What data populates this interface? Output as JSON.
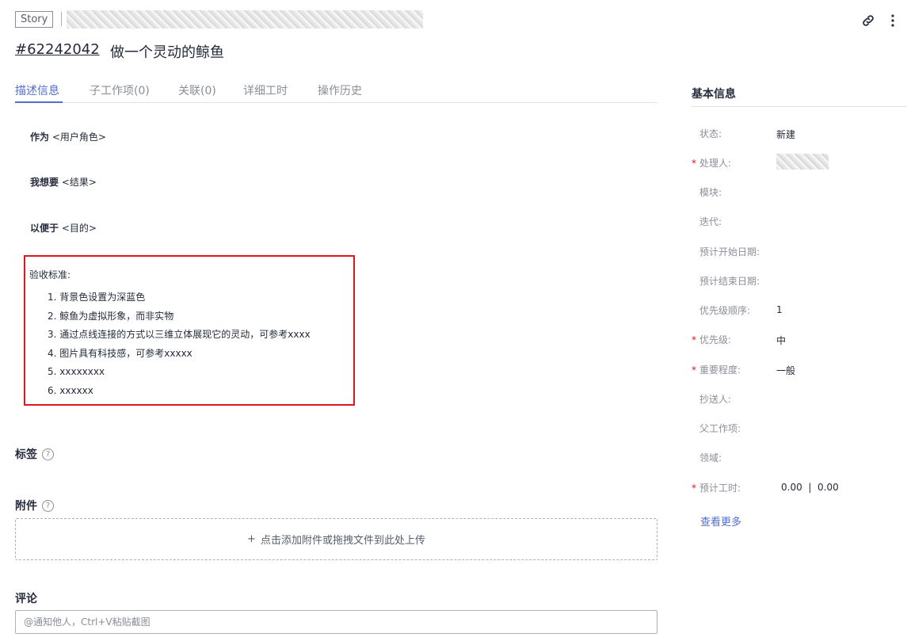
{
  "header": {
    "type_tag": "Story",
    "item_id": "#62242042",
    "item_title": "做一个灵动的鲸鱼"
  },
  "tabs": [
    {
      "label": "描述信息",
      "active": true
    },
    {
      "label": "子工作项(0)",
      "active": false
    },
    {
      "label": "关联(0)",
      "active": false
    },
    {
      "label": "详细工时",
      "active": false
    },
    {
      "label": "操作历史",
      "active": false
    }
  ],
  "description": {
    "as_label": "作为",
    "as_value": "<用户角色>",
    "want_label": "我想要",
    "want_value": "<结果>",
    "so_label": "以便于",
    "so_value": "<目的>"
  },
  "criteria": {
    "title": "验收标准:",
    "items": [
      "1. 背景色设置为深蓝色",
      "2. 鲸鱼为虚拟形象，而非实物",
      "3. 通过点线连接的方式以三维立体展现它的灵动，可参考xxxx",
      "4. 图片具有科技感，可参考xxxxx",
      "5. xxxxxxxx",
      "6. xxxxxx"
    ]
  },
  "tags": {
    "label": "标签",
    "help": "?"
  },
  "attachments": {
    "label": "附件",
    "help": "?",
    "upload_text": "点击添加附件或拖拽文件到此处上传",
    "upload_plus": "+"
  },
  "comments": {
    "label": "评论",
    "placeholder": "@通知他人，Ctrl+V粘贴截图"
  },
  "side_panel": {
    "title": "基本信息",
    "fields": [
      {
        "label": "状态:",
        "value": "新建",
        "required": false
      },
      {
        "label": "处理人:",
        "value": "",
        "required": true
      },
      {
        "label": "模块:",
        "value": "",
        "required": false
      },
      {
        "label": "迭代:",
        "value": "",
        "required": false
      },
      {
        "label": "预计开始日期:",
        "value": "",
        "required": false
      },
      {
        "label": "预计结束日期:",
        "value": "",
        "required": false
      },
      {
        "label": "优先级顺序:",
        "value": "1",
        "required": false
      },
      {
        "label": "优先级:",
        "value": "中",
        "required": true
      },
      {
        "label": "重要程度:",
        "value": "一般",
        "required": true
      },
      {
        "label": "抄送人:",
        "value": "",
        "required": false
      },
      {
        "label": "父工作项:",
        "value": "",
        "required": false
      },
      {
        "label": "领域:",
        "value": "",
        "required": false
      },
      {
        "label": "预计工时:",
        "value": "0.00  |  0.00",
        "required": true
      }
    ],
    "see_more": "查看更多"
  },
  "colors": {
    "accent": "#526ecc",
    "required": "#e0161c",
    "highlight_box": "#e0161c"
  },
  "icons": {
    "link": "link-icon",
    "more": "more-vertical-icon",
    "help": "help-circle-icon",
    "plus": "plus-icon"
  }
}
